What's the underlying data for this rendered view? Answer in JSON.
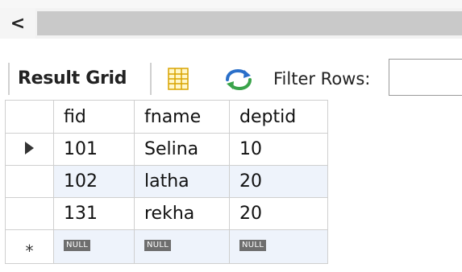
{
  "scrollbar": {
    "left_arrow": "<"
  },
  "toolbar": {
    "result_grid_label": "Result Grid",
    "filter_rows_label": "Filter Rows:",
    "filter_value": ""
  },
  "grid": {
    "columns": [
      "fid",
      "fname",
      "deptid"
    ],
    "rows": [
      {
        "fid": "101",
        "fname": "Selina",
        "deptid": "10"
      },
      {
        "fid": "102",
        "fname": "latha",
        "deptid": "20"
      },
      {
        "fid": "131",
        "fname": "rekha",
        "deptid": "20"
      }
    ],
    "new_row": {
      "fid": "NULL",
      "fname": "NULL",
      "deptid": "NULL"
    },
    "new_row_marker": "*"
  },
  "icons": {
    "grid_icon": "grid-layout-icon",
    "refresh_icon": "refresh-icon",
    "row_pointer": "row-pointer-icon"
  },
  "colors": {
    "alt_row": "#eef3fb",
    "null_badge": "#6e6e6e",
    "scroll_thumb": "#c9c9c9"
  }
}
